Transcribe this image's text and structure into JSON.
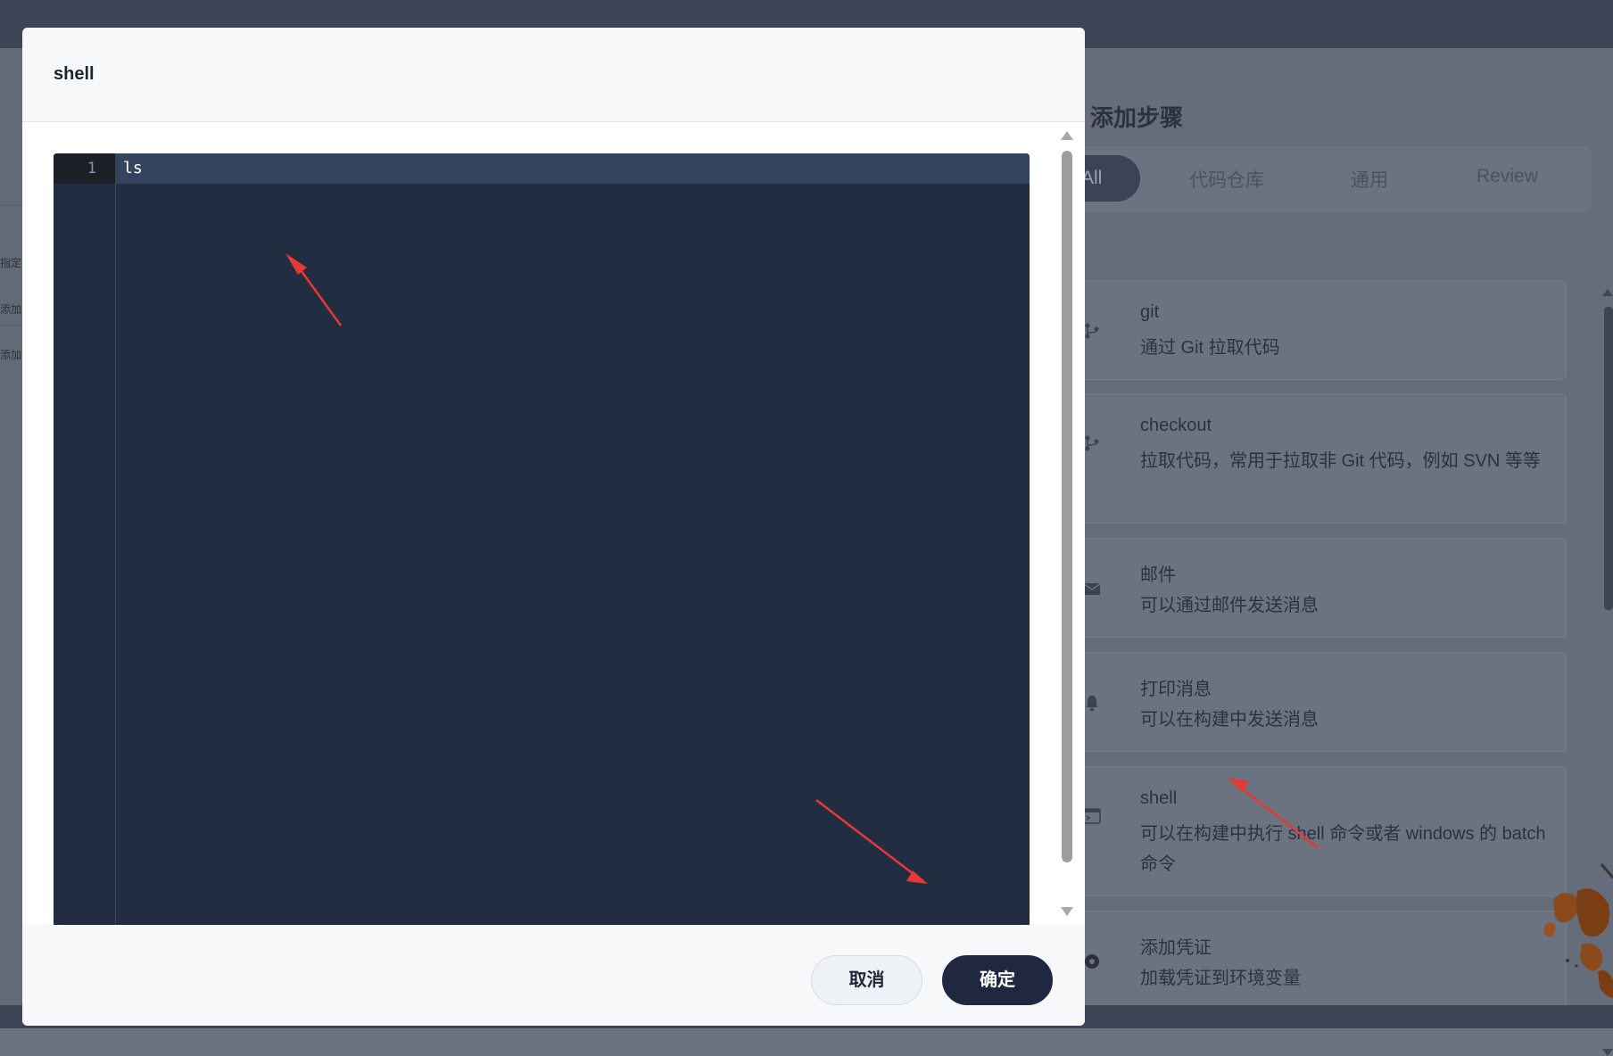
{
  "modal": {
    "title": "shell",
    "editor": {
      "lines": [
        {
          "number": "1",
          "text": "ls"
        }
      ]
    },
    "cancel_label": "取消",
    "confirm_label": "确定"
  },
  "background_panel": {
    "title": "添加步骤",
    "tabs": [
      "All",
      "代码仓库",
      "通用",
      "Review"
    ],
    "active_tab": "All",
    "steps": [
      {
        "name": "git",
        "desc": "通过 Git 拉取代码",
        "icon": "git-branch-icon"
      },
      {
        "name": "checkout",
        "desc": "拉取代码，常用于拉取非 Git 代码，例如 SVN 等等",
        "icon": "git-branch-icon"
      },
      {
        "name": "邮件",
        "desc": "可以通过邮件发送消息",
        "icon": "mail-icon"
      },
      {
        "name": "打印消息",
        "desc": "可以在构建中发送消息",
        "icon": "bell-icon"
      },
      {
        "name": "shell",
        "desc": "可以在构建中执行 shell 命令或者 windows 的 batch 命令",
        "icon": "terminal-icon"
      },
      {
        "name": "添加凭证",
        "desc": "加载凭证到环境变量",
        "icon": "credential-icon"
      }
    ]
  },
  "background_left": {
    "items": [
      "指定节",
      "添加步",
      "添加并"
    ]
  },
  "colors": {
    "overlay": "#6b7280",
    "editor_bg": "#232d42",
    "confirm_bg": "#1f2840",
    "annotation_arrow": "#e53935"
  }
}
